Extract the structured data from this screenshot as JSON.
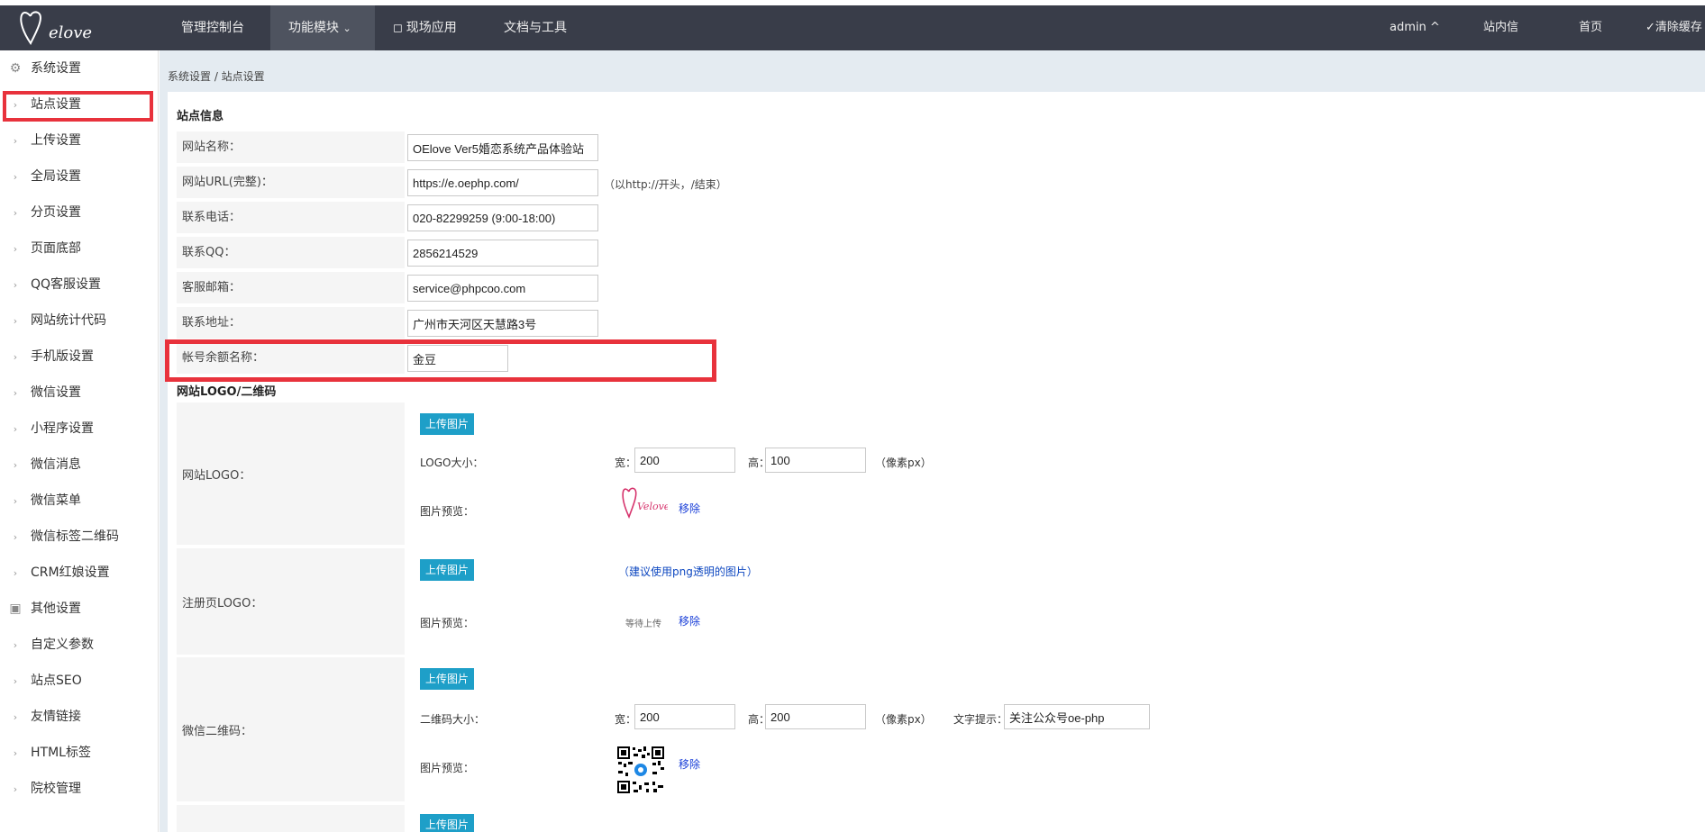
{
  "header": {
    "logo_icon": "oelove-logo",
    "nav": [
      "管理控制台",
      "功能模块",
      "现场应用",
      "文档与工具"
    ],
    "nav_active_index": 1,
    "nav_chevron": "chevron-down-icon",
    "right": {
      "admin": "admin ^",
      "messages": "站内信",
      "home": "首页",
      "clear_cache": "清除缓存"
    }
  },
  "sidebar": {
    "group1": "系统设置",
    "items1": [
      "站点设置",
      "上传设置",
      "全局设置",
      "分页设置",
      "页面底部",
      "QQ客服设置",
      "网站统计代码",
      "手机版设置",
      "微信设置",
      "小程序设置",
      "微信消息",
      "微信菜单",
      "微信标签二维码",
      "CRM红娘设置"
    ],
    "group2": "其他设置",
    "items2": [
      "自定义参数",
      "站点SEO",
      "友情链接",
      "HTML标签",
      "院校管理"
    ],
    "active_item": "站点设置"
  },
  "breadcrumb": "系统设置 / 站点设置",
  "site_info": {
    "title": "站点信息",
    "fields": [
      {
        "label": "网站名称：",
        "value": "OElove Ver5婚恋系统产品体验站"
      },
      {
        "label": "网站URL(完整)：",
        "value": "https://e.oephp.com/",
        "hint": "（以http://开头，/结束）"
      },
      {
        "label": "联系电话：",
        "value": "020-82299259 (9:00-18:00)"
      },
      {
        "label": "联系QQ：",
        "value": "2856214529"
      },
      {
        "label": "客服邮箱：",
        "value": "service@phpcoo.com"
      },
      {
        "label": "联系地址：",
        "value": "广州市天河区天慧路3号"
      },
      {
        "label": "帐号余额名称：",
        "value": "金豆"
      }
    ]
  },
  "logo_section": {
    "title": "网站LOGO/二维码",
    "site_logo": {
      "label": "网站LOGO：",
      "upload": "上传图片",
      "size_label": "LOGO大小：",
      "width_label": "宽：",
      "width": "200",
      "height_label": "高：",
      "height": "100",
      "unit": "（像素px）",
      "preview_label": "图片预览：",
      "preview_logo_text": "Velove",
      "remove": "移除"
    },
    "reg_logo": {
      "label": "注册页LOGO：",
      "upload": "上传图片",
      "hint": "（建议使用png透明的图片）",
      "preview_label": "图片预览：",
      "waiting": "等待上传",
      "remove": "移除"
    },
    "wechat_qr": {
      "label": "微信二维码：",
      "upload": "上传图片",
      "size_label": "二维码大小：",
      "width_label": "宽：",
      "width": "200",
      "height_label": "高：",
      "height": "200",
      "unit": "（像素px）",
      "tip_label": "文字提示：",
      "tip": "关注公众号oe-php",
      "preview_label": "图片预览：",
      "remove": "移除"
    },
    "next_upload": "上传图片"
  },
  "colors": {
    "topbar": "#393d49",
    "highlight": "#e8323c",
    "upload": "#1e9fc8",
    "link": "#1a3fd8"
  }
}
